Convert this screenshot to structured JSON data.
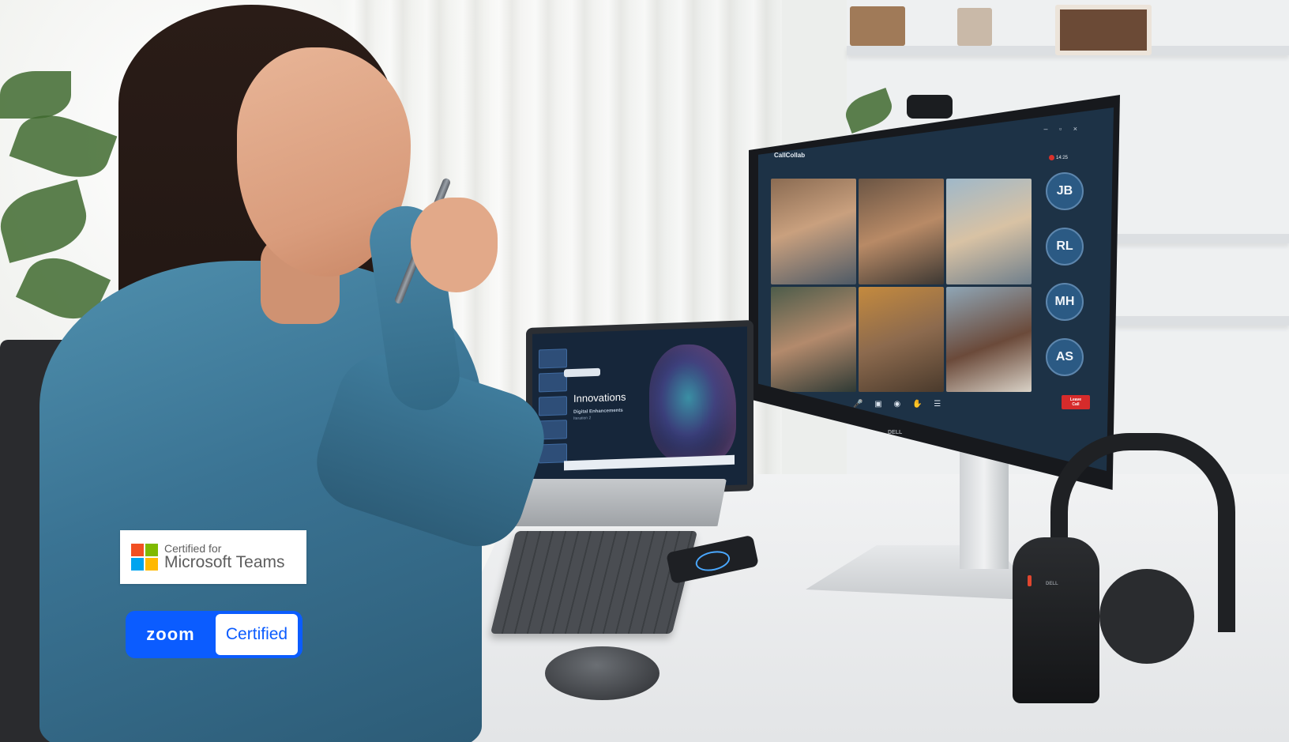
{
  "colors": {
    "zoom_blue": "#0B5CFF",
    "ms_red": "#F25022",
    "ms_green": "#7FBA00",
    "ms_blue": "#00A4EF",
    "ms_yellow": "#FFB900",
    "leave_red": "#D62B2B",
    "call_bg": "#1D3246"
  },
  "badges": {
    "microsoft": {
      "line1": "Certified for",
      "line2": "Microsoft Teams"
    },
    "zoom": {
      "logo_text": "zoom",
      "certified": "Certified"
    }
  },
  "monitor": {
    "app_name": "CallCollab",
    "rec_time": "14:25",
    "participants": [
      "JB",
      "RL",
      "MH",
      "AS"
    ],
    "leave_label": "Leave Call",
    "brand": "DELL",
    "window_controls": "– ▫ ×",
    "call_controls": "🎤 ▣ ◉ ✋ ☰",
    "tiles": [
      {
        "icon": "group-meeting-tile"
      },
      {
        "icon": "woman-speaking-tile"
      },
      {
        "icon": "office-team-tile"
      },
      {
        "icon": "woman-smiling-tile"
      },
      {
        "icon": "man-laughing-tile"
      },
      {
        "icon": "woman-laughing-tile"
      }
    ]
  },
  "laptop": {
    "slide_title": "Innovations",
    "slide_subtitle": "Digital Enhancements",
    "slide_caption": "Iteration 2"
  },
  "headset_stand": {
    "brand": "DELL"
  }
}
